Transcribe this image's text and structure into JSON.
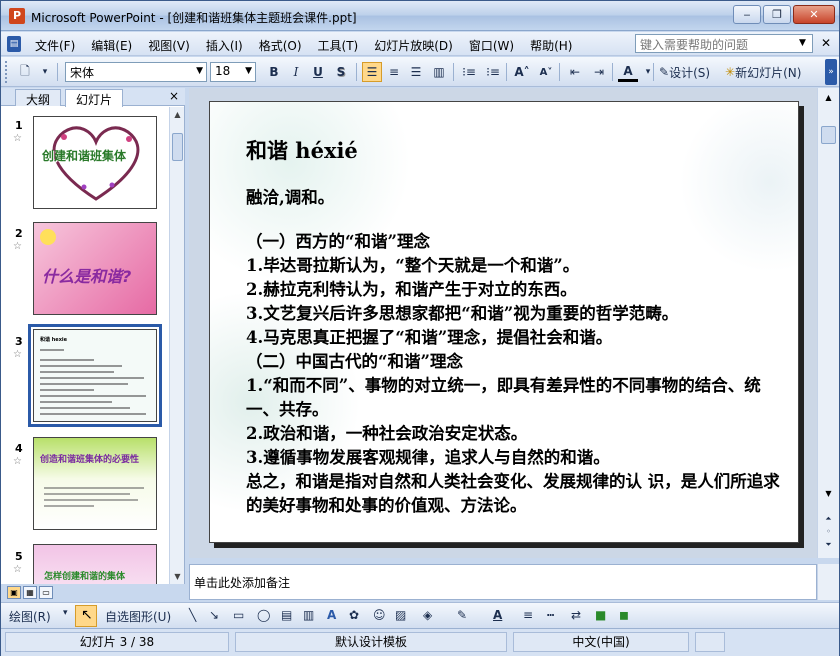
{
  "window": {
    "title": "Microsoft PowerPoint - [创建和谐班集体主题班会课件.ppt]",
    "app_icon": "P",
    "buttons": {
      "minimize": "‒",
      "restore": "❐",
      "close": "✕"
    }
  },
  "menubar": {
    "items": [
      "文件(F)",
      "编辑(E)",
      "视图(V)",
      "插入(I)",
      "格式(O)",
      "工具(T)",
      "幻灯片放映(D)",
      "窗口(W)",
      "帮助(H)"
    ],
    "help_placeholder": "键入需要帮助的问题",
    "close_doc": "✕"
  },
  "toolbar": {
    "font_name": "宋体",
    "font_size": "18",
    "bold": "B",
    "italic": "I",
    "underline": "U",
    "shadow": "S",
    "design_label": "设计(S)",
    "new_slide_label": "新幻灯片(N)"
  },
  "leftpane": {
    "tabs": [
      "大纲",
      "幻灯片"
    ],
    "active_tab": "幻灯片",
    "close": "×",
    "thumbnails": [
      {
        "number": "1",
        "text": "创建和谐班集体"
      },
      {
        "number": "2",
        "text": "什么是和谐?"
      },
      {
        "number": "3",
        "text": "和谐 hexie"
      },
      {
        "number": "4",
        "text": "创造和谐班集体的必要性"
      },
      {
        "number": "5",
        "text": "怎样创建和谐的集体"
      }
    ]
  },
  "slide": {
    "title": "和谐 héxié",
    "lead": "融洽,调和。",
    "lines": [
      "（一）西方的“和谐”理念",
      "1.毕达哥拉斯认为，“整个天就是一个和谐”。",
      "2.赫拉克利特认为，和谐产生于对立的东西。",
      "3.文艺复兴后许多思想家都把“和谐”视为重要的哲学范畴。",
      "4.马克思真正把握了“和谐”理念，提倡社会和谐。",
      "（二）中国古代的“和谐”理念",
      "1.“和而不同”、事物的对立统一，即具有差异性的不同事物的结合、统一、共存。",
      "2.政治和谐，一种社会政治安定状态。",
      "3.遵循事物发展客观规律，追求人与自然的和谐。",
      "总之，和谐是指对自然和人类社会变化、发展规律的认 识，是人们所追求的美好事物和处事的价值观、方法论。"
    ]
  },
  "notes": {
    "placeholder": "单击此处添加备注"
  },
  "drawbar": {
    "draw_label": "绘图(R)",
    "autoshapes_label": "自选图形(U)"
  },
  "statusbar": {
    "slide_pos": "幻灯片 3 / 38",
    "template": "默认设计模板",
    "language": "中文(中国)"
  },
  "colors": {
    "accent": "#2b5aa8",
    "highlight": "#ffd88a"
  }
}
